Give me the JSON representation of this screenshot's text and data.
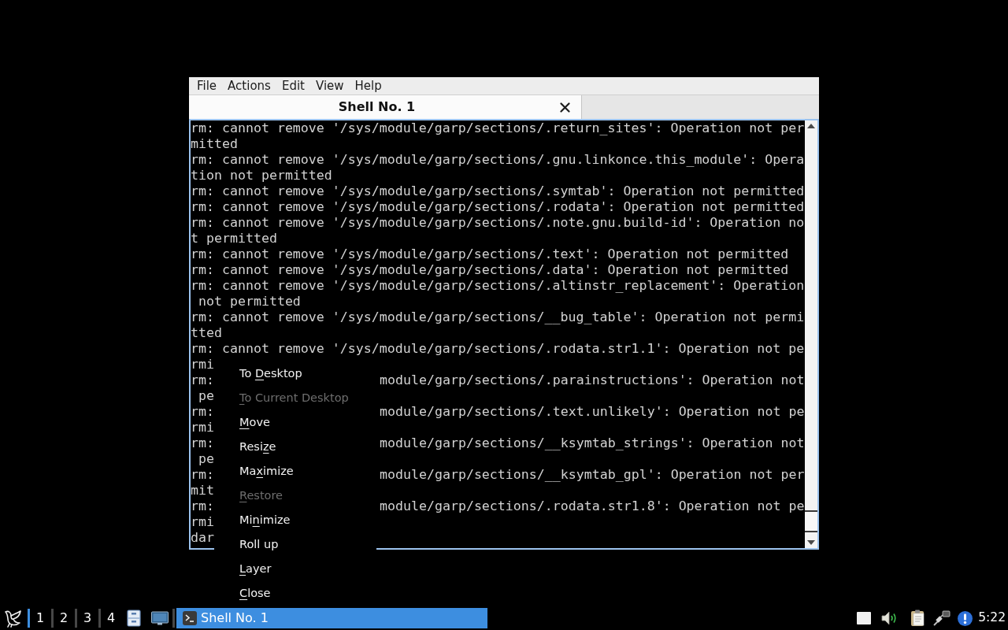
{
  "window": {
    "menu_bar": [
      "File",
      "Actions",
      "Edit",
      "View",
      "Help"
    ],
    "tabs": [
      {
        "label": "Shell No. 1",
        "selected": true
      }
    ],
    "terminal": {
      "rows": [
        {
          "kind": "full",
          "text": "rm: cannot remove '/sys/module/garp/sections/.return_sites': Operation not per"
        },
        {
          "kind": "full",
          "text": "mitted"
        },
        {
          "kind": "full",
          "text": "rm: cannot remove '/sys/module/garp/sections/.gnu.linkonce.this_module': Opera"
        },
        {
          "kind": "full",
          "text": "tion not permitted"
        },
        {
          "kind": "full",
          "text": "rm: cannot remove '/sys/module/garp/sections/.symtab': Operation not permitted"
        },
        {
          "kind": "full",
          "text": "rm: cannot remove '/sys/module/garp/sections/.rodata': Operation not permitted"
        },
        {
          "kind": "full",
          "text": "rm: cannot remove '/sys/module/garp/sections/.note.gnu.build-id': Operation no"
        },
        {
          "kind": "full",
          "text": "t permitted"
        },
        {
          "kind": "full",
          "text": "rm: cannot remove '/sys/module/garp/sections/.text': Operation not permitted"
        },
        {
          "kind": "full",
          "text": "rm: cannot remove '/sys/module/garp/sections/.data': Operation not permitted"
        },
        {
          "kind": "full",
          "text": "rm: cannot remove '/sys/module/garp/sections/.altinstr_replacement': Operation"
        },
        {
          "kind": "full",
          "text": " not permitted"
        },
        {
          "kind": "full",
          "text": "rm: cannot remove '/sys/module/garp/sections/__bug_table': Operation not permi"
        },
        {
          "kind": "full",
          "text": "tted"
        },
        {
          "kind": "full",
          "text": "rm: cannot remove '/sys/module/garp/sections/.rodata.str1.1': Operation not pe"
        },
        {
          "kind": "full",
          "text": "rmi"
        },
        {
          "kind": "split",
          "left": "rm:",
          "right": "module/garp/sections/.parainstructions': Operation not"
        },
        {
          "kind": "full",
          "text": " pe"
        },
        {
          "kind": "split",
          "left": "rm:",
          "right": "module/garp/sections/.text.unlikely': Operation not pe"
        },
        {
          "kind": "full",
          "text": "rmi"
        },
        {
          "kind": "split",
          "left": "rm:",
          "right": "module/garp/sections/__ksymtab_strings': Operation not"
        },
        {
          "kind": "full",
          "text": " pe"
        },
        {
          "kind": "split",
          "left": "rm:",
          "right": "module/garp/sections/__ksymtab_gpl': Operation not per"
        },
        {
          "kind": "full",
          "text": "mit"
        },
        {
          "kind": "split",
          "left": "rm:",
          "right": "module/garp/sections/.rodata.str1.8': Operation not pe"
        },
        {
          "kind": "full",
          "text": "rmi"
        },
        {
          "kind": "full",
          "text": "dar"
        }
      ]
    }
  },
  "context_menu": {
    "items": [
      {
        "before": "To ",
        "key": "D",
        "after": "esktop",
        "disabled": false
      },
      {
        "key": "T",
        "after": "o Current Desktop",
        "disabled": true
      },
      {
        "key": "M",
        "after": "ove",
        "disabled": false
      },
      {
        "before": "Resi",
        "key": "z",
        "after": "e",
        "disabled": false
      },
      {
        "before": "Ma",
        "key": "x",
        "after": "imize",
        "disabled": false
      },
      {
        "key": "R",
        "after": "estore",
        "disabled": true
      },
      {
        "before": "Mi",
        "key": "n",
        "after": "imize",
        "disabled": false
      },
      {
        "before": "Roll up",
        "disabled": false
      },
      {
        "key": "L",
        "after": "ayer",
        "disabled": false
      },
      {
        "key": "C",
        "after": "lose",
        "disabled": false
      }
    ]
  },
  "taskbar": {
    "workspaces": [
      {
        "label": "1",
        "selected": true
      },
      {
        "label": "2",
        "selected": false
      },
      {
        "label": "3",
        "selected": false
      },
      {
        "label": "4",
        "selected": false
      }
    ],
    "tasks": [
      {
        "label": "Shell No. 1",
        "selected": true
      }
    ],
    "clock": "5:22"
  }
}
